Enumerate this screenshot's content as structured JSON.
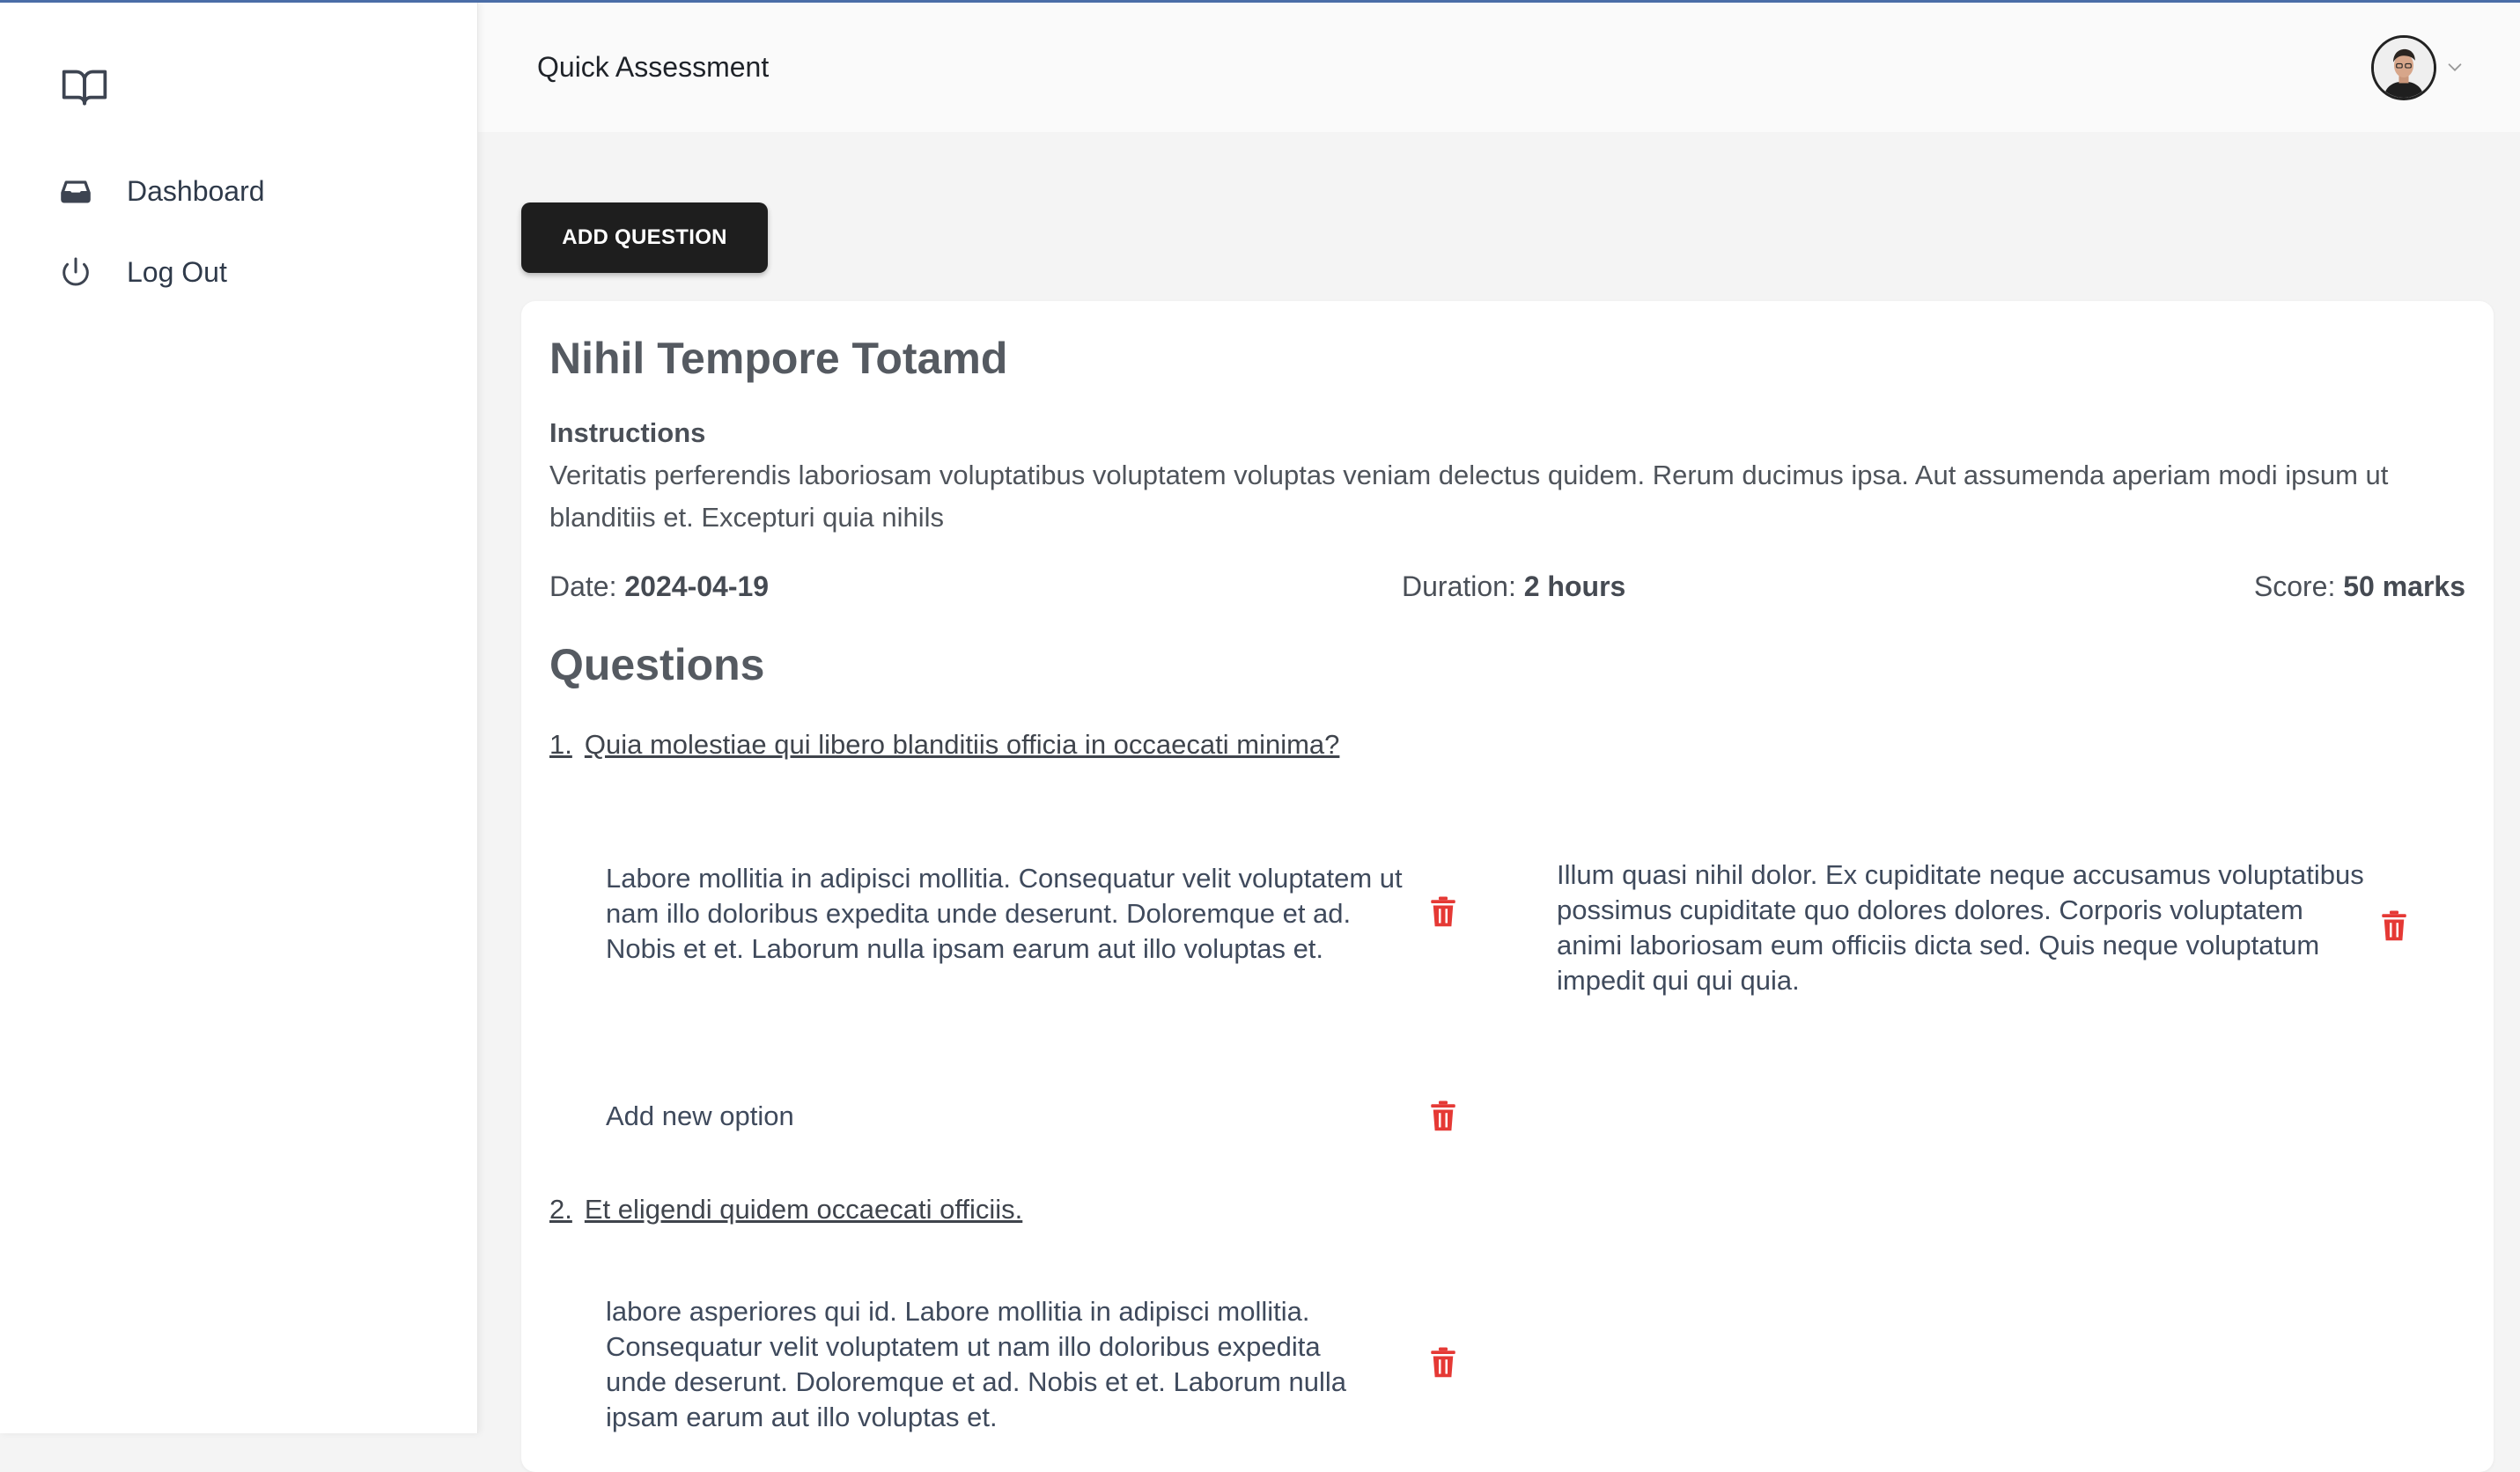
{
  "header": {
    "title": "Quick Assessment"
  },
  "sidebar": {
    "items": [
      {
        "label": "Dashboard",
        "icon": "inbox-icon"
      },
      {
        "label": "Log Out",
        "icon": "power-icon"
      }
    ]
  },
  "toolbar": {
    "add_question_label": "ADD QUESTION"
  },
  "assessment": {
    "title": "Nihil Tempore Totamd",
    "instructions_heading": "Instructions",
    "instructions": "Veritatis perferendis laboriosam voluptatibus voluptatem voluptas veniam delectus quidem. Rerum ducimus ipsa. Aut assumenda aperiam modi ipsum ut blanditiis et. Excepturi quia nihils",
    "date_label": "Date:",
    "date": "2024-04-19",
    "duration_label": "Duration:",
    "duration": "2 hours",
    "score_label": "Score:",
    "score": "50 marks"
  },
  "questions_heading": "Questions",
  "questions": [
    {
      "number": "1.",
      "text": "Quia molestiae qui libero blanditiis officia in occaecati minima?",
      "options": [
        "Labore mollitia in adipisci mollitia. Consequatur velit voluptatem ut nam illo doloribus expedita unde deserunt. Doloremque et ad. Nobis et et. Laborum nulla ipsam earum aut illo voluptas et.",
        "Illum quasi nihil dolor. Ex cupiditate neque accusamus voluptatibus possimus cupiditate quo dolores dolores. Corporis voluptatem animi laboriosam eum officiis dicta sed. Quis neque voluptatum impedit qui qui quia.",
        "Add new option"
      ]
    },
    {
      "number": "2.",
      "text": "Et eligendi quidem occaecati officiis.",
      "options": [
        "labore asperiores qui id. Labore mollitia in adipisci mollitia. Consequatur velit voluptatem ut nam illo doloribus expedita unde deserunt. Doloremque et ad. Nobis et et. Laborum nulla ipsam earum aut illo voluptas et."
      ]
    }
  ],
  "colors": {
    "delete": "#e53935",
    "button_bg": "#1e1e1e",
    "accent_line": "#4a6da7"
  }
}
